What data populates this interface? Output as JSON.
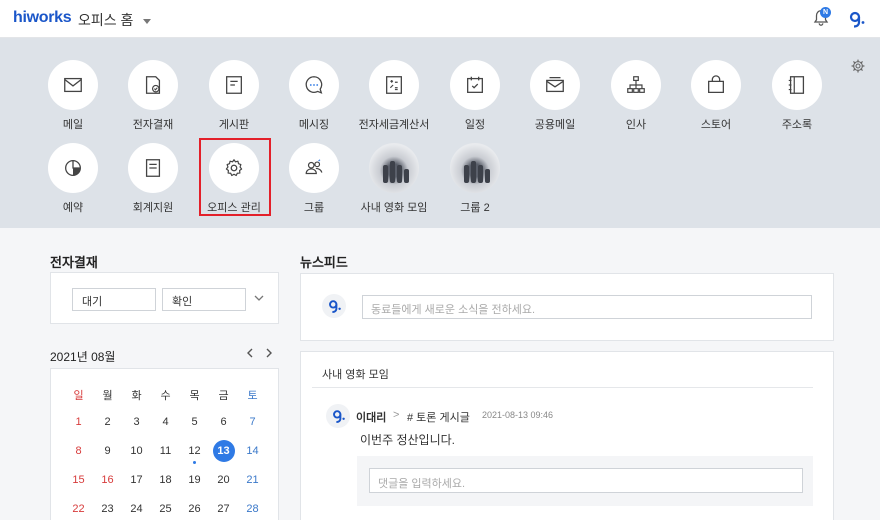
{
  "header": {
    "logo": "hiworks",
    "title": "오피스 홈",
    "notification_count": "N"
  },
  "apps": [
    {
      "label": "메일",
      "icon": "mail-icon"
    },
    {
      "label": "전자결재",
      "icon": "approval-icon"
    },
    {
      "label": "게시판",
      "icon": "board-icon"
    },
    {
      "label": "메시징",
      "icon": "message-icon"
    },
    {
      "label": "전자세금계산서",
      "icon": "tax-invoice-icon"
    },
    {
      "label": "일정",
      "icon": "calendar-icon"
    },
    {
      "label": "공용메일",
      "icon": "shared-mail-icon"
    },
    {
      "label": "인사",
      "icon": "org-chart-icon"
    },
    {
      "label": "스토어",
      "icon": "store-icon"
    },
    {
      "label": "주소록",
      "icon": "address-book-icon"
    },
    {
      "label": "예약",
      "icon": "reservation-icon"
    },
    {
      "label": "회계지원",
      "icon": "accounting-icon"
    },
    {
      "label": "오피스 관리",
      "icon": "gear-icon"
    },
    {
      "label": "그룹",
      "icon": "group-icon"
    },
    {
      "label": "사내 영화 모임",
      "icon": "group-photo-icon"
    },
    {
      "label": "그룹 2",
      "icon": "group-photo-icon"
    }
  ],
  "approval": {
    "title": "전자결재",
    "waiting": "대기",
    "confirm": "확인"
  },
  "calendar": {
    "month": "2021년 08월",
    "weekdays": [
      "일",
      "월",
      "화",
      "수",
      "목",
      "금",
      "토"
    ],
    "weeks": [
      [
        "1",
        "2",
        "3",
        "4",
        "5",
        "6",
        "7"
      ],
      [
        "8",
        "9",
        "10",
        "11",
        "12",
        "13",
        "14"
      ],
      [
        "15",
        "16",
        "17",
        "18",
        "19",
        "20",
        "21"
      ],
      [
        "22",
        "23",
        "24",
        "25",
        "26",
        "27",
        "28"
      ]
    ],
    "today": "13",
    "event_day": "12",
    "holiday": "16",
    "accent": "#2f7ae5"
  },
  "newsfeed": {
    "title": "뉴스피드",
    "placeholder": "동료들에게 새로운 소식을 전하세요."
  },
  "group_post": {
    "group": "사내 영화 모임",
    "author": "이대리",
    "separator": ">",
    "board": "# 토론 게시글",
    "date": "2021-08-13 09:46",
    "text": "이번주 정산입니다.",
    "comment_placeholder": "댓글을 입력하세요."
  }
}
